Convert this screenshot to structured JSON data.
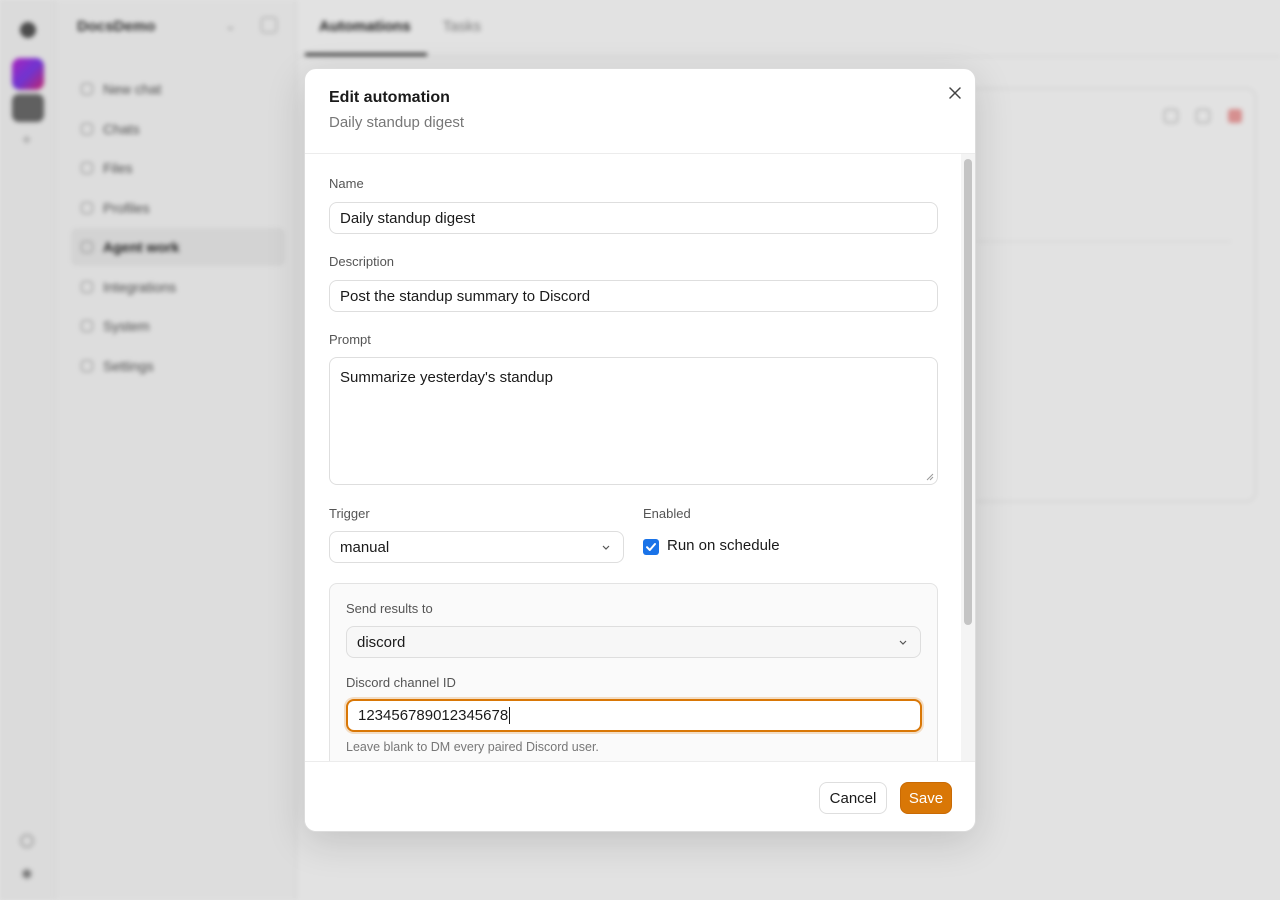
{
  "sidebar": {
    "workspace_name": "DocsDemo",
    "items": [
      {
        "label": "New chat",
        "icon": "plus-square-icon"
      },
      {
        "label": "Chats",
        "icon": "chat-icon"
      },
      {
        "label": "Files",
        "icon": "folder-icon"
      },
      {
        "label": "Profiles",
        "icon": "profile-icon"
      },
      {
        "label": "Agent work",
        "icon": "agent-icon",
        "active": true
      },
      {
        "label": "Integrations",
        "icon": "plug-icon"
      },
      {
        "label": "System",
        "icon": "system-icon"
      },
      {
        "label": "Settings",
        "icon": "gear-icon"
      }
    ]
  },
  "main": {
    "tabs": [
      {
        "label": "Automations",
        "active": true
      },
      {
        "label": "Tasks",
        "active": false
      }
    ]
  },
  "dialog": {
    "title": "Edit automation",
    "subtitle": "Daily standup digest",
    "close_icon": "close-icon",
    "fields": {
      "name": {
        "label": "Name",
        "value": "Daily standup digest"
      },
      "description": {
        "label": "Description",
        "value": "Post the standup summary to Discord"
      },
      "prompt": {
        "label": "Prompt",
        "value": "Summarize yesterday's standup"
      },
      "trigger": {
        "label": "Trigger",
        "value": "manual"
      },
      "enabled": {
        "label": "Enabled",
        "checkbox_label": "Run on schedule",
        "checked": true
      },
      "send_results_to": {
        "label": "Send results to",
        "value": "discord"
      },
      "discord_channel": {
        "label": "Discord channel ID",
        "value": "123456789012345678",
        "hint": "Leave blank to DM every paired Discord user."
      }
    },
    "footer": {
      "cancel_label": "Cancel",
      "save_label": "Save"
    }
  },
  "colors": {
    "accent": "#d97706",
    "checkbox": "#1a73e8"
  }
}
